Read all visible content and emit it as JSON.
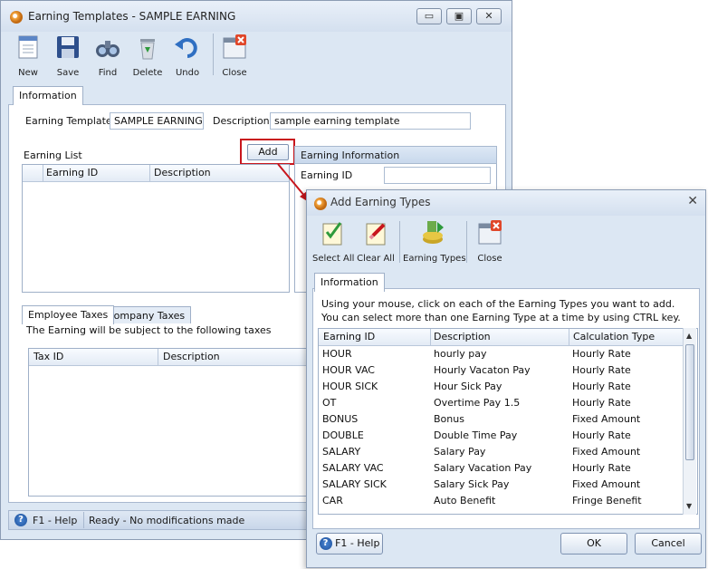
{
  "main": {
    "title": "Earning Templates - SAMPLE EARNING",
    "window_buttons": {
      "minimize": "▭",
      "maximize": "▣",
      "close": "✕"
    },
    "toolbar": {
      "new": "New",
      "save": "Save",
      "find": "Find",
      "delete": "Delete",
      "undo": "Undo",
      "close": "Close"
    },
    "tab_information": "Information",
    "earning_template_label": "Earning Template",
    "earning_template_value": "SAMPLE EARNING",
    "description_label": "Description",
    "description_value": "sample earning template",
    "earning_list_label": "Earning List",
    "add_button": "Add",
    "earning_list_columns": {
      "id": "Earning ID",
      "desc": "Description"
    },
    "earning_info_header": "Earning Information",
    "earning_info_id_label": "Earning ID",
    "tab_employee_taxes": "Employee Taxes",
    "tab_company_taxes": "Company Taxes",
    "taxes_note": "The Earning will be subject to the following taxes",
    "tax_columns": {
      "id": "Tax ID",
      "desc": "Description"
    },
    "status_help": "F1 - Help",
    "status_text": "Ready - No modifications made"
  },
  "dialog": {
    "title": "Add Earning Types",
    "close_glyph": "✕",
    "toolbar": {
      "select_all": "Select All",
      "clear_all": "Clear All",
      "earning_types": "Earning Types",
      "close": "Close"
    },
    "tab_information": "Information",
    "instruction_1": "Using your mouse, click on each of the Earning Types you want to add.",
    "instruction_2": "You can select more than one Earning Type at a time by using CTRL key.",
    "columns": {
      "id": "Earning ID",
      "desc": "Description",
      "calc": "Calculation Type"
    },
    "rows": [
      {
        "id": "HOUR",
        "desc": "hourly pay",
        "calc": "Hourly Rate"
      },
      {
        "id": "HOUR VAC",
        "desc": "Hourly Vacaton Pay",
        "calc": "Hourly Rate"
      },
      {
        "id": "HOUR SICK",
        "desc": "Hour Sick Pay",
        "calc": "Hourly Rate"
      },
      {
        "id": "OT",
        "desc": "Overtime Pay 1.5",
        "calc": "Hourly Rate"
      },
      {
        "id": "BONUS",
        "desc": "Bonus",
        "calc": "Fixed Amount"
      },
      {
        "id": "DOUBLE",
        "desc": "Double Time Pay",
        "calc": "Hourly Rate"
      },
      {
        "id": "SALARY",
        "desc": "Salary Pay",
        "calc": "Fixed Amount"
      },
      {
        "id": "SALARY VAC",
        "desc": "Salary Vacation Pay",
        "calc": "Hourly Rate"
      },
      {
        "id": "SALARY SICK",
        "desc": "Salary Sick Pay",
        "calc": "Fixed Amount"
      },
      {
        "id": "CAR",
        "desc": "Auto Benefit",
        "calc": "Fringe Benefit"
      }
    ],
    "help_button": "F1 - Help",
    "ok_button": "OK",
    "cancel_button": "Cancel"
  },
  "colors": {
    "highlight": "#c8161d",
    "accent": "#1c4f9a",
    "panel": "#dce7f3"
  }
}
